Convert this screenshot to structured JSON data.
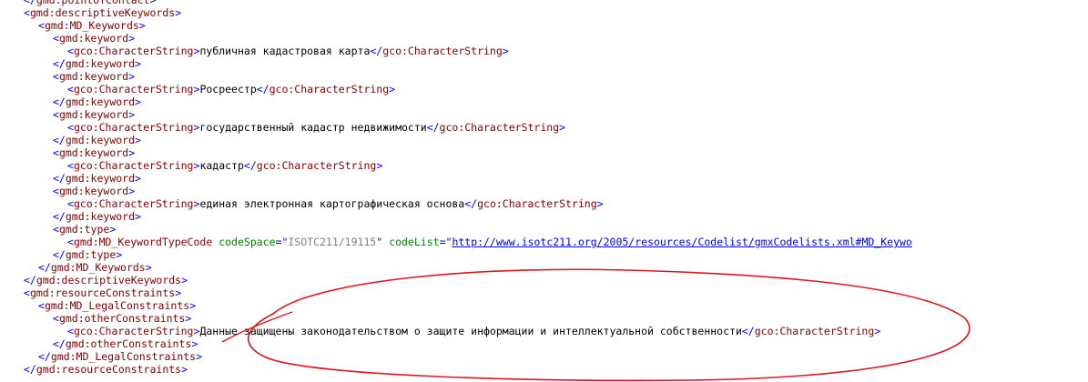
{
  "colors": {
    "bracket": "#0000ff",
    "tag_name": "#800000",
    "attribute_name": "#008000",
    "attribute_value": "#808080",
    "text": "#000000",
    "link": "#0000ee",
    "annotation_ellipse": "#e0141e"
  },
  "lines": [
    {
      "indent": 2,
      "tokens": [
        {
          "t": "p",
          "v": "</"
        },
        {
          "t": "n",
          "v": "gmd:pointOfContact"
        },
        {
          "t": "p",
          "v": ">"
        }
      ]
    },
    {
      "indent": 2,
      "tokens": [
        {
          "t": "p",
          "v": "<"
        },
        {
          "t": "n",
          "v": "gmd:descriptiveKeywords"
        },
        {
          "t": "p",
          "v": ">"
        }
      ]
    },
    {
      "indent": 4,
      "tokens": [
        {
          "t": "p",
          "v": "<"
        },
        {
          "t": "n",
          "v": "gmd:MD_Keywords"
        },
        {
          "t": "p",
          "v": ">"
        }
      ]
    },
    {
      "indent": 6,
      "tokens": [
        {
          "t": "p",
          "v": "<"
        },
        {
          "t": "n",
          "v": "gmd:keyword"
        },
        {
          "t": "p",
          "v": ">"
        }
      ]
    },
    {
      "indent": 8,
      "tokens": [
        {
          "t": "p",
          "v": "<"
        },
        {
          "t": "n",
          "v": "gco:CharacterString"
        },
        {
          "t": "p",
          "v": ">"
        },
        {
          "t": "x",
          "v": "публичная кадастровая карта"
        },
        {
          "t": "p",
          "v": "</"
        },
        {
          "t": "n",
          "v": "gco:CharacterString"
        },
        {
          "t": "p",
          "v": ">"
        }
      ]
    },
    {
      "indent": 6,
      "tokens": [
        {
          "t": "p",
          "v": "</"
        },
        {
          "t": "n",
          "v": "gmd:keyword"
        },
        {
          "t": "p",
          "v": ">"
        }
      ]
    },
    {
      "indent": 6,
      "tokens": [
        {
          "t": "p",
          "v": "<"
        },
        {
          "t": "n",
          "v": "gmd:keyword"
        },
        {
          "t": "p",
          "v": ">"
        }
      ]
    },
    {
      "indent": 8,
      "tokens": [
        {
          "t": "p",
          "v": "<"
        },
        {
          "t": "n",
          "v": "gco:CharacterString"
        },
        {
          "t": "p",
          "v": ">"
        },
        {
          "t": "x",
          "v": "Росреестр"
        },
        {
          "t": "p",
          "v": "</"
        },
        {
          "t": "n",
          "v": "gco:CharacterString"
        },
        {
          "t": "p",
          "v": ">"
        }
      ]
    },
    {
      "indent": 6,
      "tokens": [
        {
          "t": "p",
          "v": "</"
        },
        {
          "t": "n",
          "v": "gmd:keyword"
        },
        {
          "t": "p",
          "v": ">"
        }
      ]
    },
    {
      "indent": 6,
      "tokens": [
        {
          "t": "p",
          "v": "<"
        },
        {
          "t": "n",
          "v": "gmd:keyword"
        },
        {
          "t": "p",
          "v": ">"
        }
      ]
    },
    {
      "indent": 8,
      "tokens": [
        {
          "t": "p",
          "v": "<"
        },
        {
          "t": "n",
          "v": "gco:CharacterString"
        },
        {
          "t": "p",
          "v": ">"
        },
        {
          "t": "x",
          "v": "государственный кадастр недвижимости"
        },
        {
          "t": "p",
          "v": "</"
        },
        {
          "t": "n",
          "v": "gco:CharacterString"
        },
        {
          "t": "p",
          "v": ">"
        }
      ]
    },
    {
      "indent": 6,
      "tokens": [
        {
          "t": "p",
          "v": "</"
        },
        {
          "t": "n",
          "v": "gmd:keyword"
        },
        {
          "t": "p",
          "v": ">"
        }
      ]
    },
    {
      "indent": 6,
      "tokens": [
        {
          "t": "p",
          "v": "<"
        },
        {
          "t": "n",
          "v": "gmd:keyword"
        },
        {
          "t": "p",
          "v": ">"
        }
      ]
    },
    {
      "indent": 8,
      "tokens": [
        {
          "t": "p",
          "v": "<"
        },
        {
          "t": "n",
          "v": "gco:CharacterString"
        },
        {
          "t": "p",
          "v": ">"
        },
        {
          "t": "x",
          "v": "кадастр"
        },
        {
          "t": "p",
          "v": "</"
        },
        {
          "t": "n",
          "v": "gco:CharacterString"
        },
        {
          "t": "p",
          "v": ">"
        }
      ]
    },
    {
      "indent": 6,
      "tokens": [
        {
          "t": "p",
          "v": "</"
        },
        {
          "t": "n",
          "v": "gmd:keyword"
        },
        {
          "t": "p",
          "v": ">"
        }
      ]
    },
    {
      "indent": 6,
      "tokens": [
        {
          "t": "p",
          "v": "<"
        },
        {
          "t": "n",
          "v": "gmd:keyword"
        },
        {
          "t": "p",
          "v": ">"
        }
      ]
    },
    {
      "indent": 8,
      "tokens": [
        {
          "t": "p",
          "v": "<"
        },
        {
          "t": "n",
          "v": "gco:CharacterString"
        },
        {
          "t": "p",
          "v": ">"
        },
        {
          "t": "x",
          "v": "единая электронная картографическая основа"
        },
        {
          "t": "p",
          "v": "</"
        },
        {
          "t": "n",
          "v": "gco:CharacterString"
        },
        {
          "t": "p",
          "v": ">"
        }
      ]
    },
    {
      "indent": 6,
      "tokens": [
        {
          "t": "p",
          "v": "</"
        },
        {
          "t": "n",
          "v": "gmd:keyword"
        },
        {
          "t": "p",
          "v": ">"
        }
      ]
    },
    {
      "indent": 6,
      "tokens": [
        {
          "t": "p",
          "v": "<"
        },
        {
          "t": "n",
          "v": "gmd:type"
        },
        {
          "t": "p",
          "v": ">"
        }
      ]
    },
    {
      "indent": 8,
      "tokens": [
        {
          "t": "p",
          "v": "<"
        },
        {
          "t": "n",
          "v": "gmd:MD_KeywordTypeCode"
        },
        {
          "t": "x",
          "v": " "
        },
        {
          "t": "a",
          "v": "codeSpace"
        },
        {
          "t": "p",
          "v": "=\""
        },
        {
          "t": "v",
          "v": "ISOTC211/19115"
        },
        {
          "t": "p",
          "v": "\""
        },
        {
          "t": "x",
          "v": " "
        },
        {
          "t": "a",
          "v": "codeList"
        },
        {
          "t": "p",
          "v": "=\""
        },
        {
          "t": "l",
          "v": "http://www.isotc211.org/2005/resources/Codelist/gmxCodelists.xml#MD_Keywo"
        }
      ]
    },
    {
      "indent": 6,
      "tokens": [
        {
          "t": "p",
          "v": "</"
        },
        {
          "t": "n",
          "v": "gmd:type"
        },
        {
          "t": "p",
          "v": ">"
        }
      ]
    },
    {
      "indent": 4,
      "tokens": [
        {
          "t": "p",
          "v": "</"
        },
        {
          "t": "n",
          "v": "gmd:MD_Keywords"
        },
        {
          "t": "p",
          "v": ">"
        }
      ]
    },
    {
      "indent": 2,
      "tokens": [
        {
          "t": "p",
          "v": "</"
        },
        {
          "t": "n",
          "v": "gmd:descriptiveKeywords"
        },
        {
          "t": "p",
          "v": ">"
        }
      ]
    },
    {
      "indent": 2,
      "tokens": [
        {
          "t": "p",
          "v": "<"
        },
        {
          "t": "n",
          "v": "gmd:resourceConstraints"
        },
        {
          "t": "p",
          "v": ">"
        }
      ]
    },
    {
      "indent": 4,
      "tokens": [
        {
          "t": "p",
          "v": "<"
        },
        {
          "t": "n",
          "v": "gmd:MD_LegalConstraints"
        },
        {
          "t": "p",
          "v": ">"
        }
      ]
    },
    {
      "indent": 6,
      "tokens": [
        {
          "t": "p",
          "v": "<"
        },
        {
          "t": "n",
          "v": "gmd:otherConstraints"
        },
        {
          "t": "p",
          "v": ">"
        }
      ]
    },
    {
      "indent": 8,
      "tokens": [
        {
          "t": "p",
          "v": "<"
        },
        {
          "t": "n",
          "v": "gco:CharacterString"
        },
        {
          "t": "p",
          "v": ">"
        },
        {
          "t": "x",
          "v": "Данные защищены законодательством о защите информации и интеллектуальной собственности"
        },
        {
          "t": "p",
          "v": "</"
        },
        {
          "t": "n",
          "v": "gco:CharacterString"
        },
        {
          "t": "p",
          "v": ">"
        }
      ]
    },
    {
      "indent": 6,
      "tokens": [
        {
          "t": "p",
          "v": "</"
        },
        {
          "t": "n",
          "v": "gmd:otherConstraints"
        },
        {
          "t": "p",
          "v": ">"
        }
      ]
    },
    {
      "indent": 4,
      "tokens": [
        {
          "t": "p",
          "v": "</"
        },
        {
          "t": "n",
          "v": "gmd:MD_LegalConstraints"
        },
        {
          "t": "p",
          "v": ">"
        }
      ]
    },
    {
      "indent": 2,
      "tokens": [
        {
          "t": "p",
          "v": "</"
        },
        {
          "t": "n",
          "v": "gmd:resourceConstraints"
        },
        {
          "t": "p",
          "v": ">"
        }
      ]
    }
  ]
}
